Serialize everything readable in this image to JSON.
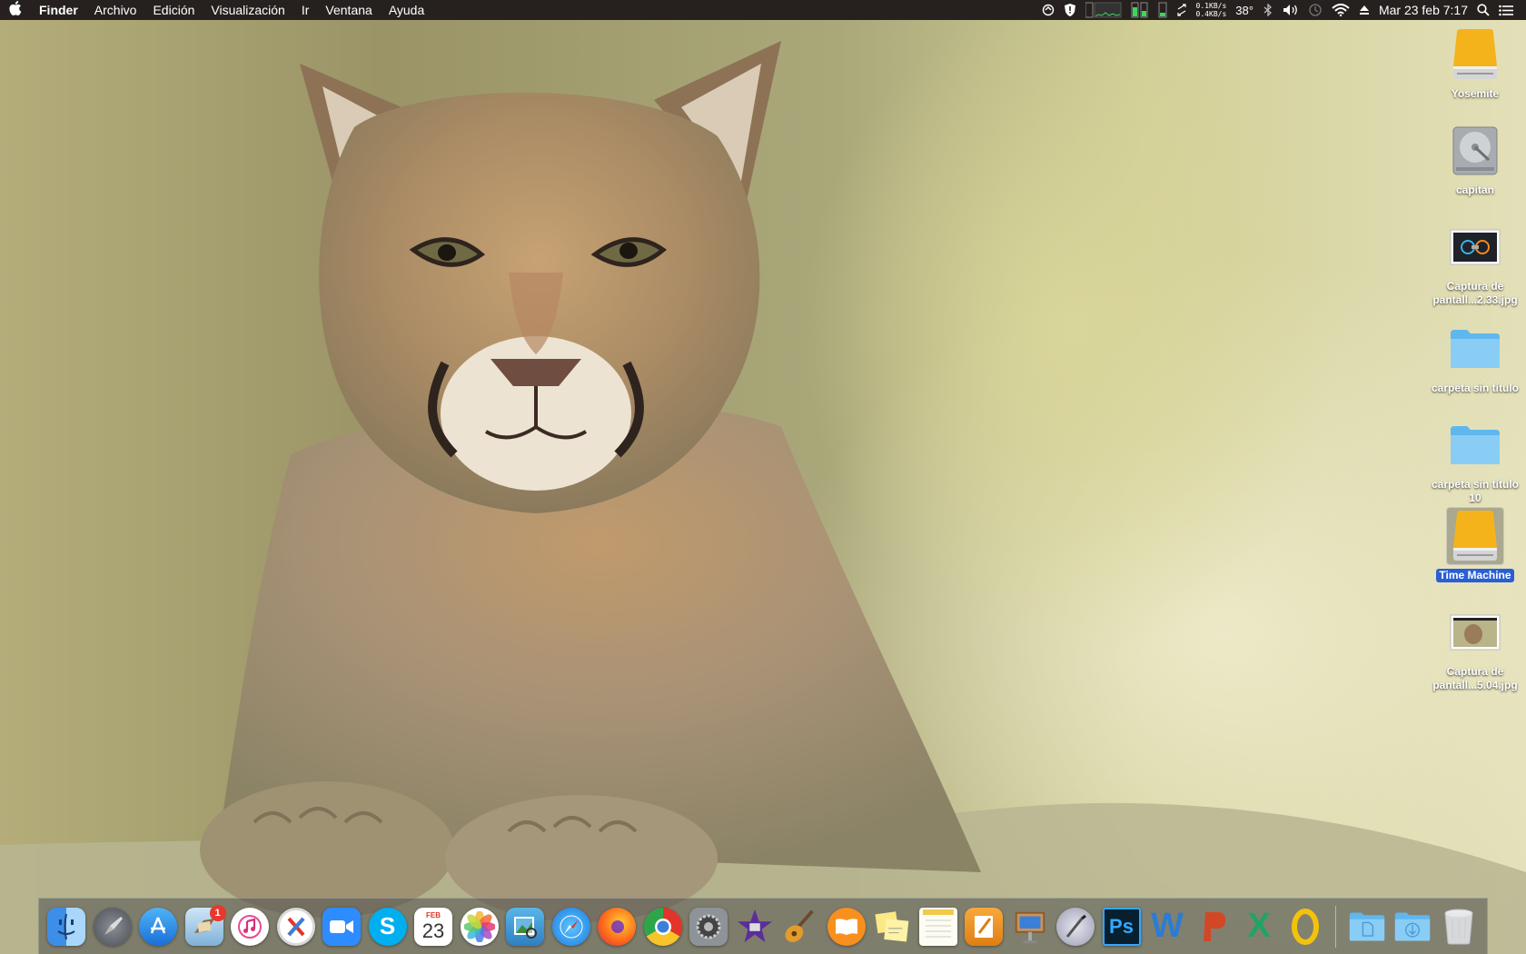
{
  "menubar": {
    "app_name": "Finder",
    "items": [
      "Archivo",
      "Edición",
      "Visualización",
      "Ir",
      "Ventana",
      "Ayuda"
    ],
    "net_up": "0.1KB/s",
    "net_down": "0.4KB/s",
    "temperature": "38°",
    "clock": "Mar 23 feb  7:17",
    "status_icons": [
      "sync-icon",
      "shield-icon",
      "cpu-meter-icon",
      "memory-meter-icon",
      "disk-meter-icon",
      "arrows-icon",
      "bluetooth-icon",
      "volume-icon",
      "time-machine-icon",
      "wifi-icon",
      "eject-icon",
      "spotlight-icon",
      "notification-list-icon"
    ]
  },
  "desktop": {
    "items": [
      {
        "label": "Yosemite",
        "icon": "external-drive-icon",
        "selected": false
      },
      {
        "label": "capitan",
        "icon": "internal-drive-icon",
        "selected": false
      },
      {
        "label": "Captura de pantall...2.33.jpg",
        "icon": "screenshot-thumbnail-icon",
        "selected": false
      },
      {
        "label": "carpeta sin título",
        "icon": "folder-icon",
        "selected": false
      },
      {
        "label": "carpeta sin título 10",
        "icon": "folder-icon",
        "selected": false
      },
      {
        "label": "Time Machine",
        "icon": "external-drive-icon",
        "selected": true
      },
      {
        "label": "Captura de pantall...5.04.jpg",
        "icon": "screenshot-thumbnail-icon",
        "selected": false
      }
    ]
  },
  "dock": {
    "mail_badge": "1",
    "calendar_month": "FEB",
    "calendar_day": "23",
    "photoshop_label": "Ps",
    "word_label": "W",
    "excel_label": "X",
    "skype_label": "S",
    "app_icons": [
      "finder-icon",
      "launchpad-icon",
      "app-store-icon",
      "mail-icon",
      "itunes-icon",
      "crossover-icon",
      "zoom-icon",
      "skype-icon",
      "calendar-icon",
      "photos-icon",
      "preview-icon",
      "safari-icon",
      "firefox-icon",
      "chrome-icon",
      "system-preferences-icon",
      "imovie-icon",
      "garageband-icon",
      "ibooks-icon",
      "stickies-icon",
      "notes-icon",
      "pages-icon",
      "keynote-icon",
      "script-editor-icon",
      "photoshop-icon",
      "word-icon",
      "powerpoint-icon",
      "excel-icon",
      "openoffice-icon",
      "documents-folder-icon",
      "downloads-folder-icon",
      "trash-icon"
    ],
    "colors": {
      "accent_selection": "#2a5fd4",
      "badge": "#e8372c"
    }
  }
}
